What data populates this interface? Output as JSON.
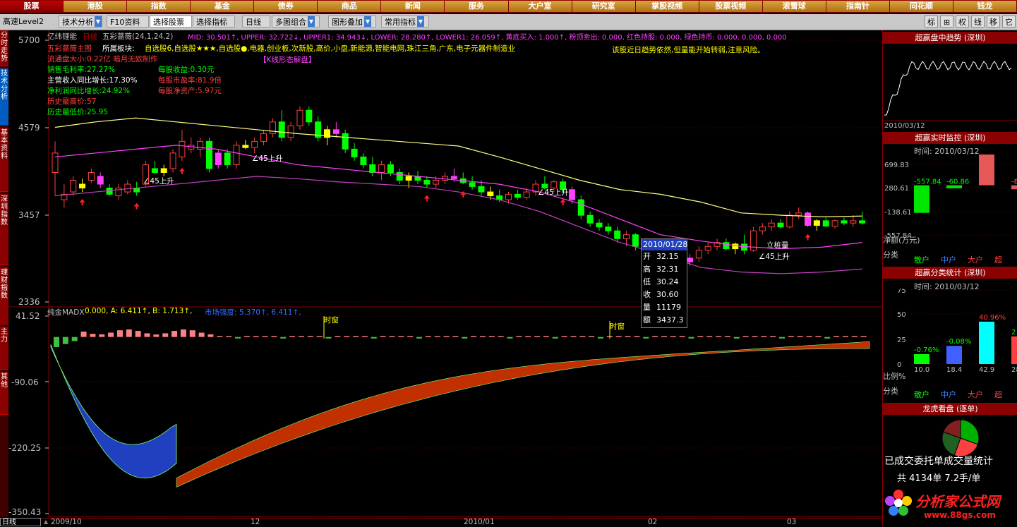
{
  "top_menu": [
    "股票",
    "港股",
    "指数",
    "基金",
    "债券",
    "商品",
    "新闻",
    "服务",
    "大户室",
    "研究室",
    "掌股视频",
    "股票视频",
    "滚雪球",
    "指南针",
    "同花顺",
    "钱龙"
  ],
  "toolbar": {
    "level": "高速Level2",
    "tech": "技术分析",
    "f10": "F10资料",
    "select_stock": "选择股票",
    "select_indicator": "选择指标",
    "period": "日线",
    "multi": "多图组合",
    "overlay": "图形叠加",
    "common": "常用指标",
    "right_icons": [
      "标",
      "⊞",
      "权",
      "线",
      "移",
      "它"
    ]
  },
  "left_tabs": [
    "分时走势",
    "技术分析",
    "基本资料",
    "深圳指数",
    "理财指数",
    "主力",
    "其他"
  ],
  "stock": {
    "name": "亿纬锂能",
    "period": "日线",
    "main_chart": "五彩蔷薇(24,1,24,2)",
    "ma_line": "MID: 30.501↑, UPPER: 32.722↓, UPPER1: 34.943↓, LOWER: 28.280↑, LOWER1: 26.059↑, 黄底买入: 1.000↑, 粉顶卖出: 0.000, 红色持股: 0.000, 绿色持币: 0.000, 0.000, 0.000",
    "sub_title": "五彩蔷薇主图",
    "sectors_label": "所属板块:",
    "sectors": "自选股6,自选股★★★,自选股●,电器,创业板,次新股,高价,小盘,新能源,智能电网,珠江三角,广东,电子元器件制造业",
    "pattern_label": "【K线形态解盘】",
    "commentary": "该股近日趋势依然,但量能开始转弱,注意风险。",
    "fundamentals_left": [
      "流通盘大小:0.22亿  暗月无欧制作",
      "销售毛利率:27.27%",
      "主营收入同比增长:17.30%",
      "净利润同比增长:24.92%",
      "历史最高价:57",
      "历史最低价:25.95"
    ],
    "fundamentals_right": [
      "每股收益:0.30元",
      "每股市盈率:81.9倍",
      "每股净资产:5.97元"
    ]
  },
  "y_axis_main": [
    "5700",
    "4579",
    "3457",
    "2336"
  ],
  "y_axis_sub": [
    "41.52",
    "-90.06",
    "-220.25",
    "-350.43"
  ],
  "x_axis": [
    "2009/10",
    "12",
    "2010/01",
    "02",
    "03"
  ],
  "annotations": [
    "∠45上升",
    "∠45上升",
    "∠45上升",
    "∠45上升",
    "立桩量",
    "∠45上升"
  ],
  "sub_indicator": {
    "name": "纯金MADX",
    "values": "0.000,  A: 6.411↑, B: 1.713↑,",
    "strength": "市场强度: 5.370↑, 6.411↑,",
    "label_time": "时窗"
  },
  "tooltip": {
    "date": "2010/01/28",
    "rows": [
      [
        "开",
        "32.15"
      ],
      [
        "高",
        "32.31"
      ],
      [
        "低",
        "30.24"
      ],
      [
        "收",
        "30.60"
      ],
      [
        "量",
        "11179"
      ],
      [
        "额",
        "3437.3"
      ]
    ]
  },
  "bottom": {
    "mode": "日线"
  },
  "right_panel": {
    "trend_title": "超赢盘中趋势 (深圳)",
    "trend_date": "2010/03/12",
    "monitor_title": "超赢实时监控 (深圳)",
    "monitor_time": "时间: 2010/03/12",
    "monitor_axis": [
      "699.83",
      "280.61",
      "-138.61",
      "-557.84"
    ],
    "monitor_values": [
      "-557.84",
      "-60.86",
      "699.83",
      "-8"
    ],
    "monitor_unit": "净额(万元)",
    "categories_label": "分类",
    "categories": [
      "散户",
      "中户",
      "大户",
      "超"
    ],
    "class_title": "超赢分类统计 (深圳)",
    "class_time": "时间: 2010/03/12",
    "class_axis": [
      "75",
      "50",
      "25",
      "0"
    ],
    "class_top_values": [
      "-0.76%",
      "-0.08%",
      "40.96%",
      "2"
    ],
    "class_bottom_values": [
      "10.0",
      "18.4",
      "42.9",
      "28"
    ],
    "ratio_label": "比例%",
    "dragon_title": "龙虎看盘 (逐单)",
    "trades_label": "已成交委托单成交量统计",
    "trades_total": "共 4134单 7.2手/单",
    "watermark": "分析家公式网",
    "watermark_url": "www.88gs.com"
  },
  "chart_data": {
    "type": "candlestick",
    "ylim": [
      2336,
      5700
    ],
    "sub_ylim": [
      -350.43,
      41.52
    ],
    "x_ticks": [
      "2009/10",
      "12",
      "2010/01",
      "02",
      "03"
    ]
  }
}
